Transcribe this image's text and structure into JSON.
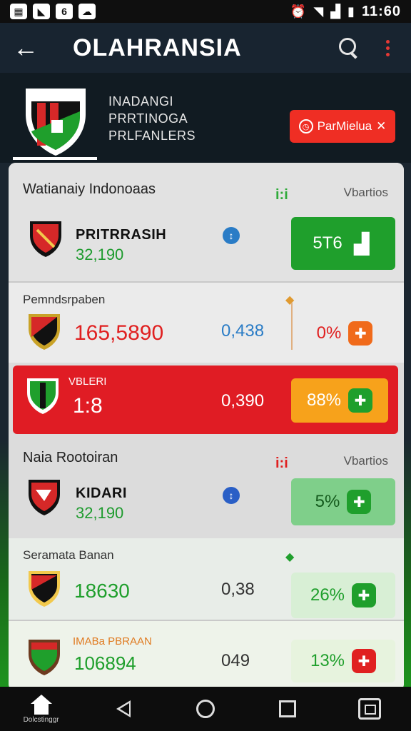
{
  "status": {
    "icons": [
      "image-icon",
      "nav-icon",
      "clock-icon",
      "messenger-icon"
    ],
    "time": "11:60"
  },
  "appbar": {
    "title": "OLAHRANSIA"
  },
  "header": {
    "lines": [
      "INADANGI",
      "PRRTINOGA",
      "PRLFANLERS"
    ],
    "button_label": "ParMielua"
  },
  "cards": [
    {
      "title": "Watianaiy Indonoaas",
      "right_label": "Vbartios",
      "mini": "i:i",
      "name": "PRITRRASIH",
      "number": "32,190",
      "pill": "5T6"
    },
    {
      "title": "Pemndsrpaben",
      "big": "165,5890",
      "mid": "0,438",
      "pill": "0%"
    },
    {
      "title": "VBLERI",
      "big": "1:8",
      "mid": "0,390",
      "pill": "88%"
    },
    {
      "title": "Naia Rootoiran",
      "right_label": "Vbartios",
      "mini": "i:i",
      "name": "KIDARI",
      "number": "32,190",
      "pill": "5%"
    },
    {
      "title": "Seramata Banan",
      "big": "18630",
      "mid": "0,38",
      "pill": "26%"
    },
    {
      "title": "IMABa PBRAAN",
      "big": "106894",
      "mid": "049",
      "pill": "13%"
    }
  ],
  "nav": {
    "home_label": "Dolcstinggr"
  },
  "colors": {
    "red": "#ef2e24",
    "green": "#1f9f2c",
    "orange": "#f59c1a",
    "header": "#182430"
  }
}
